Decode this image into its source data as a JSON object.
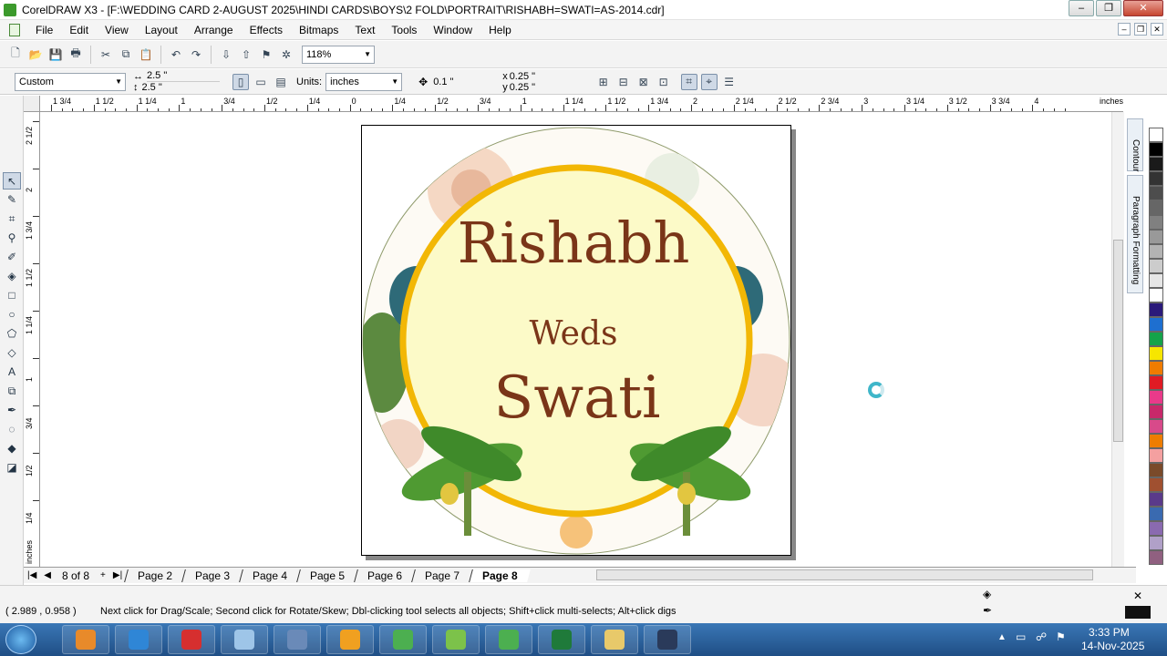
{
  "window": {
    "title": "CorelDRAW X3 - [F:\\WEDDING CARD 2-AUGUST 2025\\HINDI CARDS\\BOYS\\2 FOLD\\PORTRAIT\\RISHABH=SWATI=AS-2014.cdr]",
    "minimize": "–",
    "restore": "❐",
    "close": "✕"
  },
  "menu": [
    "File",
    "Edit",
    "View",
    "Layout",
    "Arrange",
    "Effects",
    "Bitmaps",
    "Text",
    "Tools",
    "Window",
    "Help"
  ],
  "toolbar": {
    "zoom": "118%"
  },
  "property_bar": {
    "paper_type": "Custom",
    "width": "2.5 \"",
    "height": "2.5 \"",
    "units_label": "Units:",
    "units": "inches",
    "nudge": "0.1 \"",
    "dup_x": "0.25 \"",
    "dup_y": "0.25 \"",
    "x_label": "x",
    "y_label": "y"
  },
  "ruler": {
    "h_labels": [
      "1 3/4",
      "1 1/2",
      "1 1/4",
      "1",
      "3/4",
      "1/2",
      "1/4",
      "0",
      "1/4",
      "1/2",
      "3/4",
      "1",
      "1 1/4",
      "1 1/2",
      "1 3/4",
      "2",
      "2 1/4",
      "2 1/2",
      "2 3/4",
      "3",
      "3 1/4",
      "3 1/2",
      "3 3/4",
      "4"
    ],
    "unit": "inches",
    "v_labels": [
      "2 1/2",
      "2",
      "1 3/4",
      "1 1/2",
      "1 1/4",
      "1",
      "3/4",
      "1/2",
      "1/4"
    ],
    "v_unit": "inches"
  },
  "card": {
    "groom": "Rishabh",
    "connector": "Weds",
    "bride": "Swati",
    "colors": {
      "text": "#7a3518",
      "ring": "#f2b705",
      "inner": "#fcfac8",
      "leaf": "#3f8a2a"
    }
  },
  "dockers": [
    "Contour",
    "Paragraph Formatting"
  ],
  "palette": [
    "#ffffff",
    "#000000",
    "#1a1a1a",
    "#333333",
    "#4d4d4d",
    "#666666",
    "#808080",
    "#999999",
    "#b3b3b3",
    "#cccccc",
    "#e6e6e6",
    "#ffffff",
    "#2b1a7a",
    "#1e6fd0",
    "#14a34a",
    "#f6e600",
    "#f07c00",
    "#e01b24",
    "#e93a8a",
    "#c8286a",
    "#d84a8a",
    "#ee7d00",
    "#f4a0a0",
    "#7a4a2a",
    "#a05030",
    "#5a3a8a",
    "#3a6ab0",
    "#8a6ab0",
    "#b0a0c8",
    "#906080"
  ],
  "page_nav": {
    "counter": "8 of 8",
    "add": "+",
    "tabs": [
      "Page 2",
      "Page 3",
      "Page 4",
      "Page 5",
      "Page 6",
      "Page 7",
      "Page 8"
    ],
    "active": "Page 8"
  },
  "status": {
    "coords": "( 2.989 , 0.958 )",
    "hint": "Next click for Drag/Scale; Second click for Rotate/Skew; Dbl-clicking tool selects all objects; Shift+click multi-selects; Alt+click digs"
  },
  "taskbar": {
    "time": "3:33 PM",
    "date": "14-Nov-2025",
    "apps": [
      "media-player",
      "internet-explorer",
      "opera",
      "paint",
      "winamp",
      "search",
      "chrome",
      "corel-green",
      "corel-draw",
      "excel",
      "explorer",
      "corel-app"
    ]
  }
}
